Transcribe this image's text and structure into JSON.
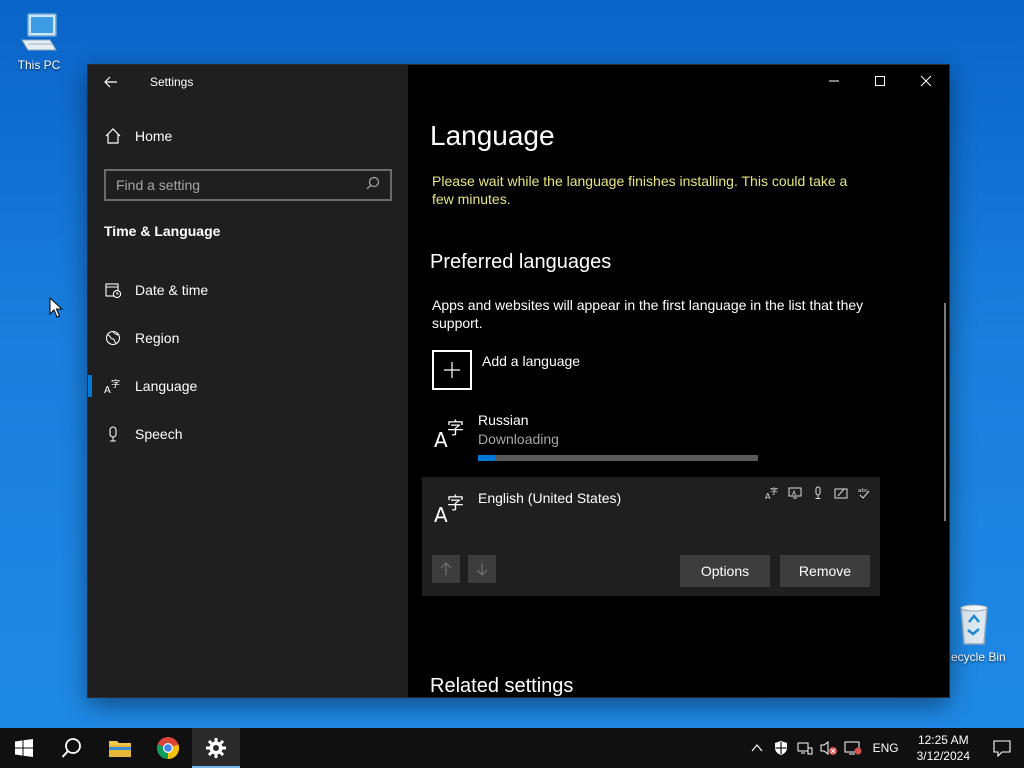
{
  "desktop": {
    "icons": [
      {
        "label": "This PC",
        "icon": "computer-icon"
      },
      {
        "label": "Recycle Bin",
        "icon": "recycle-bin-icon"
      }
    ]
  },
  "window": {
    "app_title": "Settings",
    "controls": [
      "minimize-icon",
      "maximize-icon",
      "close-icon"
    ]
  },
  "sidebar": {
    "home_label": "Home",
    "search": {
      "placeholder": "Find a setting",
      "value": ""
    },
    "section_title": "Time & Language",
    "items": [
      {
        "label": "Date & time",
        "icon": "date-time-icon",
        "active": false
      },
      {
        "label": "Region",
        "icon": "region-globe-icon",
        "active": false
      },
      {
        "label": "Language",
        "icon": "language-icon",
        "active": true
      },
      {
        "label": "Speech",
        "icon": "microphone-icon",
        "active": false
      }
    ]
  },
  "main": {
    "title": "Language",
    "warning": "Please wait while the language finishes installing. This could take a few minutes.",
    "preferred_heading": "Preferred languages",
    "preferred_desc": "Apps and websites will appear in the first language in the list that they support.",
    "add_language_label": "Add a language",
    "languages": [
      {
        "name": "Russian",
        "status": "Downloading",
        "progress_fraction": 0.06
      },
      {
        "name": "English (United States)",
        "features": [
          "language-pack-icon",
          "display-language-icon",
          "speech-icon",
          "handwriting-icon",
          "spellcheck-icon"
        ],
        "options_label": "Options",
        "remove_label": "Remove"
      }
    ],
    "related_heading": "Related settings"
  },
  "taskbar": {
    "items": [
      "start-icon",
      "search-icon",
      "file-explorer-icon",
      "chrome-icon",
      "settings-icon"
    ],
    "language_indicator": "ENG",
    "time": "12:25 AM",
    "date": "3/12/2024"
  },
  "colors": {
    "accent": "#0078d7",
    "warning_text": "#e7e67a",
    "sidebar_bg": "#1f1f1f",
    "main_bg": "#000000"
  }
}
